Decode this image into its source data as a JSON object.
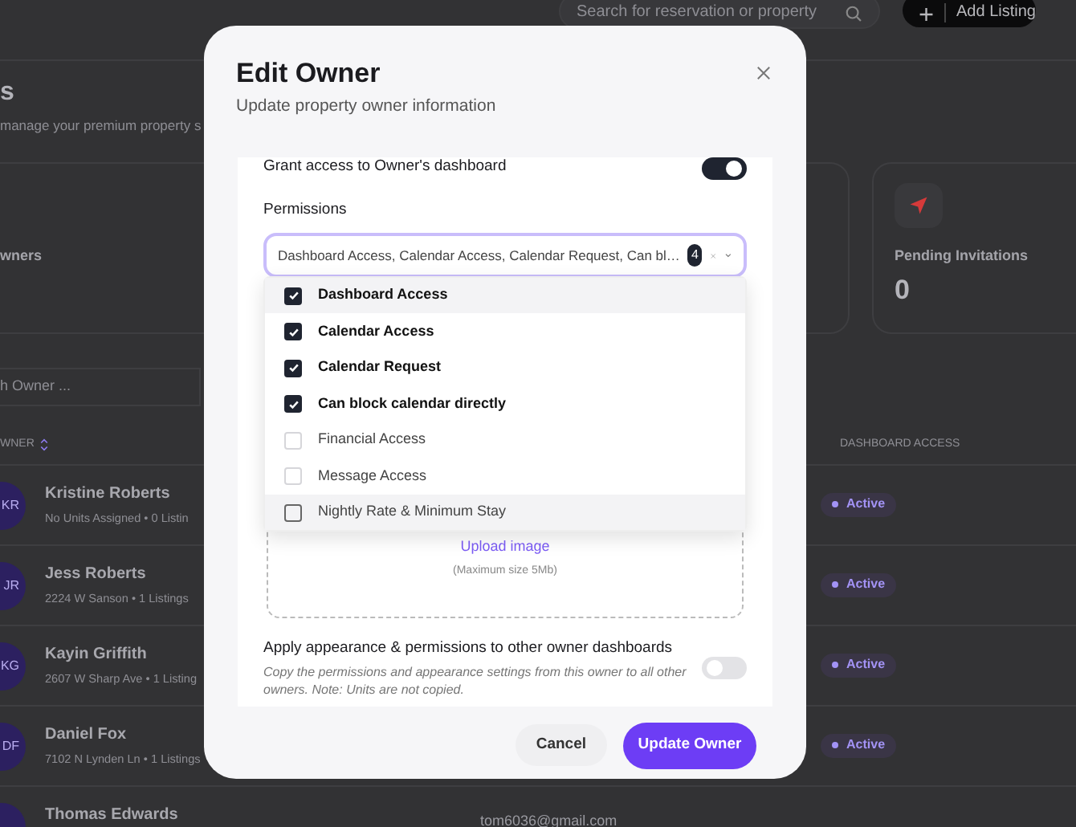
{
  "top_bar": {
    "search": {
      "placeholder": "Search for reservation or property"
    },
    "add_button": "Add Listing"
  },
  "page": {
    "title": "s",
    "subtitle": "manage your premium property s"
  },
  "stats": [
    {
      "label": "wners"
    },
    {
      "label": "Pending Invitations",
      "value": "0"
    }
  ],
  "owner_search": {
    "placeholder": "h Owner ..."
  },
  "table": {
    "columns": [
      "WNER",
      "DASHBOARD ACCESS"
    ],
    "rows": [
      {
        "initials": "KR",
        "name": "Kristine Roberts",
        "detail": "No Units Assigned • 0 Listin",
        "status": {
          "kind": "active",
          "label": "Active"
        }
      },
      {
        "initials": "JR",
        "name": "Jess Roberts",
        "detail": "2224 W Sanson • 1 Listings",
        "status": {
          "kind": "active",
          "label": "Active"
        }
      },
      {
        "initials": "KG",
        "name": "Kayin Griffith",
        "detail": "2607 W Sharp Ave • 1 Listing",
        "status": {
          "kind": "active",
          "label": "Active"
        }
      },
      {
        "initials": "DF",
        "name": "Daniel Fox",
        "detail": "7102 N Lynden Ln • 1 Listings",
        "status": {
          "kind": "active",
          "label": "Active"
        }
      },
      {
        "name": "Thomas Edwards",
        "email": "tom6036@gmail.com"
      }
    ]
  },
  "dialog": {
    "title": "Edit Owner",
    "subtitle": "Update property owner information",
    "dashboard_access": {
      "label": "Grant access to Owner's dashboard",
      "on": true
    },
    "permissions": {
      "label": "Permissions",
      "value": "Dashboard Access, Calendar Access, Calendar Request, Can bl…",
      "count": "4",
      "expanded": true,
      "options": [
        {
          "label": "Dashboard Access",
          "checked": true,
          "highlighted": true
        },
        {
          "label": "Calendar Access",
          "checked": true,
          "highlighted": false
        },
        {
          "label": "Calendar Request",
          "checked": true,
          "highlighted": false
        },
        {
          "label": "Can block calendar directly",
          "checked": true,
          "highlighted": false
        },
        {
          "label": "Financial Access",
          "checked": false,
          "highlighted": false
        },
        {
          "label": "Message Access",
          "checked": false,
          "highlighted": false
        },
        {
          "label": "Nightly Rate & Minimum Stay",
          "checked": false,
          "highlighted": true
        }
      ]
    },
    "upload": {
      "link": "Upload image",
      "note": "(Maximum size 5Mb)"
    },
    "apply_to_others": {
      "title": "Apply appearance & permissions to other owner dashboards",
      "description": "Copy the permissions and appearance settings from this owner to all other owners. Note: Units are not copied.",
      "on": false
    },
    "buttons": [
      {
        "label": "Cancel",
        "kind": "secondary"
      },
      {
        "label": "Update Owner",
        "kind": "primary"
      }
    ]
  }
}
